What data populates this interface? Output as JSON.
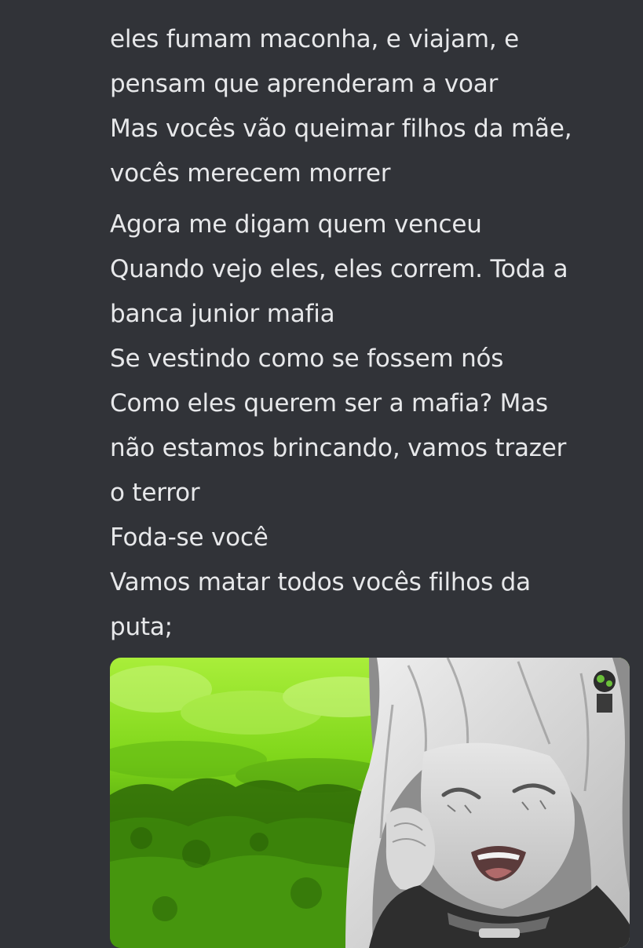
{
  "message": {
    "lines_block1": [
      "eles fumam maconha, e viajam, e",
      "pensam que aprenderam a voar",
      "Mas vocês vão queimar filhos da mãe,",
      "vocês merecem morrer"
    ],
    "lines_block2": [
      "Agora me digam quem venceu",
      "Quando vejo eles, eles correm. Toda a",
      "banca junior mafia",
      "Se vestindo como se fossem nós",
      "Como eles querem ser a mafia? Mas",
      "não estamos brincando, vamos trazer",
      "o terror",
      "Foda-se você",
      "Vamos matar todos vocês filhos da",
      "puta;"
    ]
  },
  "attachment": {
    "type": "image",
    "alt_description_icon": "anime-character-laughing-image"
  },
  "colors": {
    "background": "#313338",
    "text": "#e7e8ea",
    "green_light": "#8fe31c",
    "green_dark": "#2f6b07"
  }
}
